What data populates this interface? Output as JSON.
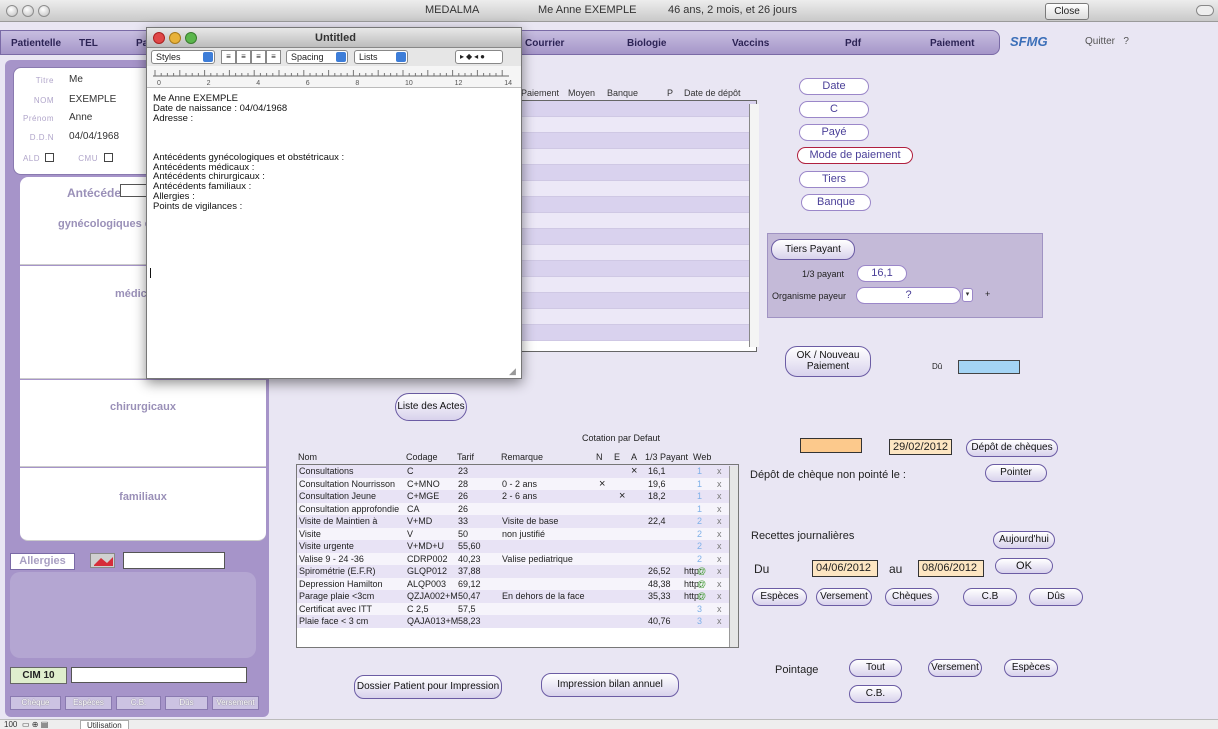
{
  "window": {
    "app_title": "MEDALMA",
    "patient_title": "Me Anne EXEMPLE",
    "age": "46 ans, 2 mois, et 26 jours",
    "close_label": "Close"
  },
  "menu": {
    "items": [
      "Patientelle",
      "TEL",
      "Pa",
      "Courrier",
      "Biologie",
      "Vaccins",
      "Pdf",
      "Paiement"
    ],
    "logo": "SFMG",
    "quit": "Quitter",
    "help": "?"
  },
  "patient": {
    "titre_label": "Titre",
    "titre": "Me",
    "nom_label": "NOM",
    "nom": "EXEMPLE",
    "prenom_label": "Prénom",
    "prenom": "Anne",
    "ddn_label": "D.D.N",
    "ddn": "04/04/1968",
    "ald_label": "ALD",
    "cmu_label": "CMU"
  },
  "antecedents": {
    "title": "Antécédents",
    "gyneco": "gynécologiques e",
    "medic": "médic",
    "chirurgicaux": "chirurgicaux",
    "familiaux": "familiaux"
  },
  "allergies_label": "Allergies",
  "cim_label": "CIM 10",
  "side_buttons": [
    "Chèque",
    "Espèces",
    "C.B.",
    "Dûs",
    "Versement"
  ],
  "payments": {
    "headers": [
      "Paiement",
      "Moyen",
      "Banque",
      "P",
      "Date de dépôt"
    ]
  },
  "sort_buttons": [
    "Date",
    "C",
    "Payé",
    "Mode de paiement",
    "Tiers",
    "Banque"
  ],
  "tiers": {
    "button": "Tiers Payant",
    "tiers_label": "1/3 payant",
    "tiers_value": "16,1",
    "org_label": "Organisme payeur",
    "org_value": "?",
    "plus": "+"
  },
  "ok_nouveau": "OK / Nouveau Paiement",
  "du_label": "Dû",
  "liste_actes": "Liste des Actes",
  "actes": {
    "cotation_label": "Cotation par Defaut",
    "headers": [
      "Nom",
      "Codage",
      "Tarif",
      "Remarque",
      "N",
      "E",
      "A",
      "1/3 Payant",
      "Web"
    ],
    "rows": [
      {
        "nom": "Consultations",
        "code": "C",
        "tarif": "23",
        "rem": "",
        "mark": "×",
        "mark_col": "A",
        "tiers": "16,1",
        "web": "",
        "num": "1"
      },
      {
        "nom": "Consultation Nourrisson",
        "code": "C+MNO",
        "tarif": "28",
        "rem": "0 - 2 ans",
        "mark": "×",
        "mark_col": "N",
        "tiers": "19,6",
        "web": "",
        "num": "1"
      },
      {
        "nom": "Consultation Jeune",
        "code": "C+MGE",
        "tarif": "26",
        "rem": "2 - 6 ans",
        "mark": "×",
        "mark_col": "E",
        "tiers": "18,2",
        "web": "",
        "num": "1"
      },
      {
        "nom": "Consultation approfondie",
        "code": "CA",
        "tarif": "26",
        "rem": "",
        "mark": "",
        "mark_col": "",
        "tiers": "",
        "web": "",
        "num": "1"
      },
      {
        "nom": "Visite de Maintien à",
        "code": "V+MD",
        "tarif": "33",
        "rem": "Visite de base",
        "mark": "",
        "mark_col": "",
        "tiers": "22,4",
        "web": "",
        "num": "2"
      },
      {
        "nom": "Visite",
        "code": "V",
        "tarif": "50",
        "rem": "non justifié",
        "mark": "",
        "mark_col": "",
        "tiers": "",
        "web": "",
        "num": "2"
      },
      {
        "nom": "Visite urgente",
        "code": "V+MD+U",
        "tarif": "55,60",
        "rem": "",
        "mark": "",
        "mark_col": "",
        "tiers": "",
        "web": "",
        "num": "2"
      },
      {
        "nom": "Valise 9 - 24 -36",
        "code": "CDRP002",
        "tarif": "40,23",
        "rem": "Valise pediatrique",
        "mark": "",
        "mark_col": "",
        "tiers": "",
        "web": "",
        "num": "2"
      },
      {
        "nom": "Spirométrie (E.F.R)",
        "code": "GLQP012",
        "tarif": "37,88",
        "rem": "",
        "mark": "",
        "mark_col": "",
        "tiers": "26,52",
        "web": "http:",
        "num": "@"
      },
      {
        "nom": "Depression Hamilton",
        "code": "ALQP003",
        "tarif": "69,12",
        "rem": "",
        "mark": "",
        "mark_col": "",
        "tiers": "48,38",
        "web": "http:",
        "num": "@"
      },
      {
        "nom": "Parage plaie <3cm",
        "code": "QZJA002+M",
        "tarif": "50,47",
        "rem": "En dehors de la face",
        "mark": "",
        "mark_col": "",
        "tiers": "35,33",
        "web": "http:",
        "num": "@"
      },
      {
        "nom": "Certificat avec ITT",
        "code": "C 2,5",
        "tarif": "57,5",
        "rem": "",
        "mark": "",
        "mark_col": "",
        "tiers": "",
        "web": "",
        "num": "3"
      },
      {
        "nom": "Plaie face < 3 cm",
        "code": "QAJA013+M",
        "tarif": "58,23",
        "rem": "",
        "mark": "",
        "mark_col": "",
        "tiers": "40,76",
        "web": "",
        "num": "3"
      }
    ]
  },
  "depot": {
    "date": "29/02/2012",
    "button": "Dépôt de chèques",
    "non_pointe_label": "Dépôt de chèque non pointé le :",
    "pointer": "Pointer"
  },
  "recettes": {
    "label": "Recettes journalières",
    "today": "Aujourd'hui",
    "du_label": "Du",
    "from": "04/06/2012",
    "au_label": "au",
    "to": "08/06/2012",
    "ok": "OK",
    "buttons": [
      "Espèces",
      "Versement",
      "Chèques",
      "C.B",
      "Dûs"
    ]
  },
  "pointage": {
    "label": "Pointage",
    "buttons": [
      "Tout",
      "Versement",
      "Espèces",
      "C.B."
    ]
  },
  "dossier_print": "Dossier Patient pour Impression",
  "bilan_print": "Impression bilan annuel",
  "status": {
    "zoom": "100",
    "mode": "Utilisation"
  },
  "editor": {
    "title": "Untitled",
    "styles": "Styles",
    "spacing": "Spacing",
    "lists": "Lists",
    "ruler_nums": [
      "0",
      "2",
      "4",
      "6",
      "8",
      "10",
      "12",
      "14"
    ],
    "content": "Me Anne EXEMPLE\nDate de naissance : 04/04/1968\nAdresse :\n\n\n\nAntécédents gynécologiques et obstétricaux :\nAntécédents médicaux :\nAntécédents chirurgicaux :\nAntécédents familiaux :\nAllergies :\nPoints de vigilances :"
  }
}
